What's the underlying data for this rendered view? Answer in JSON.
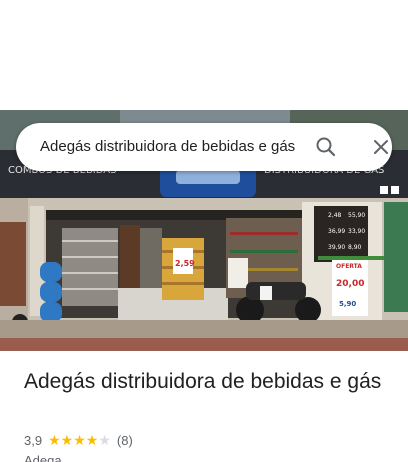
{
  "search": {
    "query": "Adegás distribuidora de bebidas e gás"
  },
  "photo": {
    "sign_left": "COMBOS DE BEBIDAS",
    "sign_right": "DISTRIBUIDORA DE GÁS",
    "price_boards": [
      "2,48",
      "55,90",
      "36,99",
      "33,90",
      "39,90",
      "8,90"
    ],
    "sale_sign_price": "2,59",
    "oferta_label": "OFERTA",
    "oferta_price_1": "20,00",
    "oferta_price_2": "5,90"
  },
  "place": {
    "title": "Adegás distribuidora de bebidas e gás",
    "rating": "3,9",
    "stars_filled": 4,
    "reviews": "(8)",
    "category": "Adega"
  },
  "colors": {
    "star": "#fbbc04",
    "star_empty": "#dadce0",
    "text_primary": "#202124",
    "text_secondary": "#5f6368"
  }
}
